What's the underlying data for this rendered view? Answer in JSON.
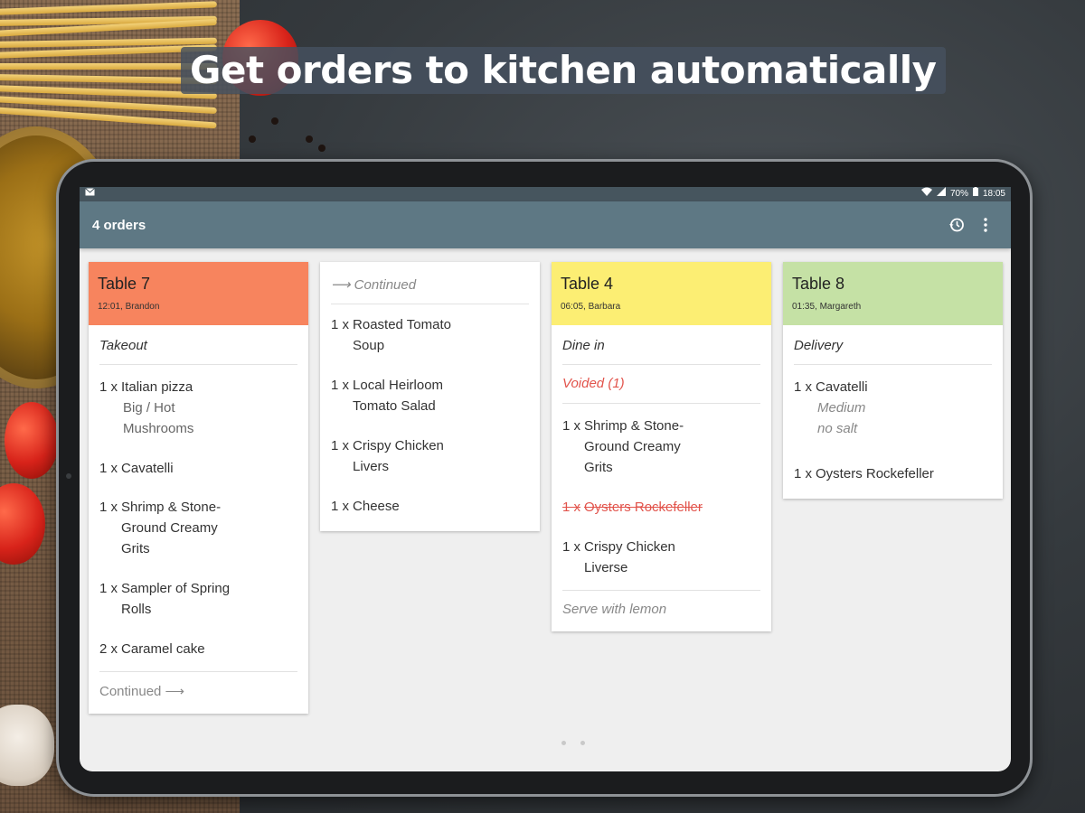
{
  "headline": "Get orders to kitchen automatically",
  "statusbar": {
    "notification_icon": "mail-icon",
    "wifi_icon": "wifi-icon",
    "signal_icon": "signal-icon",
    "battery": "70%",
    "battery_icon": "battery-icon",
    "time": "18:05"
  },
  "appbar": {
    "title": "4 orders",
    "history_icon": "history-icon",
    "menu_icon": "more-vert-icon"
  },
  "colors": {
    "appbar": "#5e7884",
    "table7": "#f7845e",
    "table4": "#fcee73",
    "table8": "#c5e1a5",
    "void": "#e2544c"
  },
  "orders": [
    {
      "table": "Table 7",
      "meta": "12:01, Brandon",
      "type": "Takeout",
      "items": [
        {
          "qty": "1 x",
          "name": "Italian pizza",
          "mods": [
            "Big / Hot",
            "Mushrooms"
          ]
        },
        {
          "qty": "1 x",
          "name": "Cavatelli"
        },
        {
          "qty": "1 x",
          "name": "Shrimp & Stone-Ground Creamy Grits"
        },
        {
          "qty": "1 x",
          "name": "Sampler of Spring Rolls"
        },
        {
          "qty": "2 x",
          "name": "Caramel cake"
        }
      ],
      "footer": "Continued ⟶"
    },
    {
      "continued": "⟶ Continued",
      "items": [
        {
          "qty": "1 x",
          "name": "Roasted Tomato Soup"
        },
        {
          "qty": "1 x",
          "name": "Local Heirloom Tomato Salad"
        },
        {
          "qty": "1 x",
          "name": "Crispy Chicken Livers"
        },
        {
          "qty": "1 x",
          "name": "Cheese"
        }
      ]
    },
    {
      "table": "Table 4",
      "meta": "06:05, Barbara",
      "type": "Dine in",
      "voided": "Voided (1)",
      "items": [
        {
          "qty": "1 x",
          "name": "Shrimp & Stone-Ground Creamy Grits"
        },
        {
          "qty": "1 x",
          "name": "Oysters Rockefeller",
          "void": true
        },
        {
          "qty": "1 x",
          "name": "Crispy Chicken Liverse"
        }
      ],
      "footer": "Serve with lemon"
    },
    {
      "table": "Table 8",
      "meta": "01:35, Margareth",
      "type": "Delivery",
      "items": [
        {
          "qty": "1 x",
          "name": "Cavatelli",
          "mods": [
            "Medium",
            "no salt"
          ]
        },
        {
          "qty": "1 x",
          "name": "Oysters Rockefeller"
        }
      ]
    }
  ],
  "pager": {
    "pages": 2,
    "current": 1
  }
}
